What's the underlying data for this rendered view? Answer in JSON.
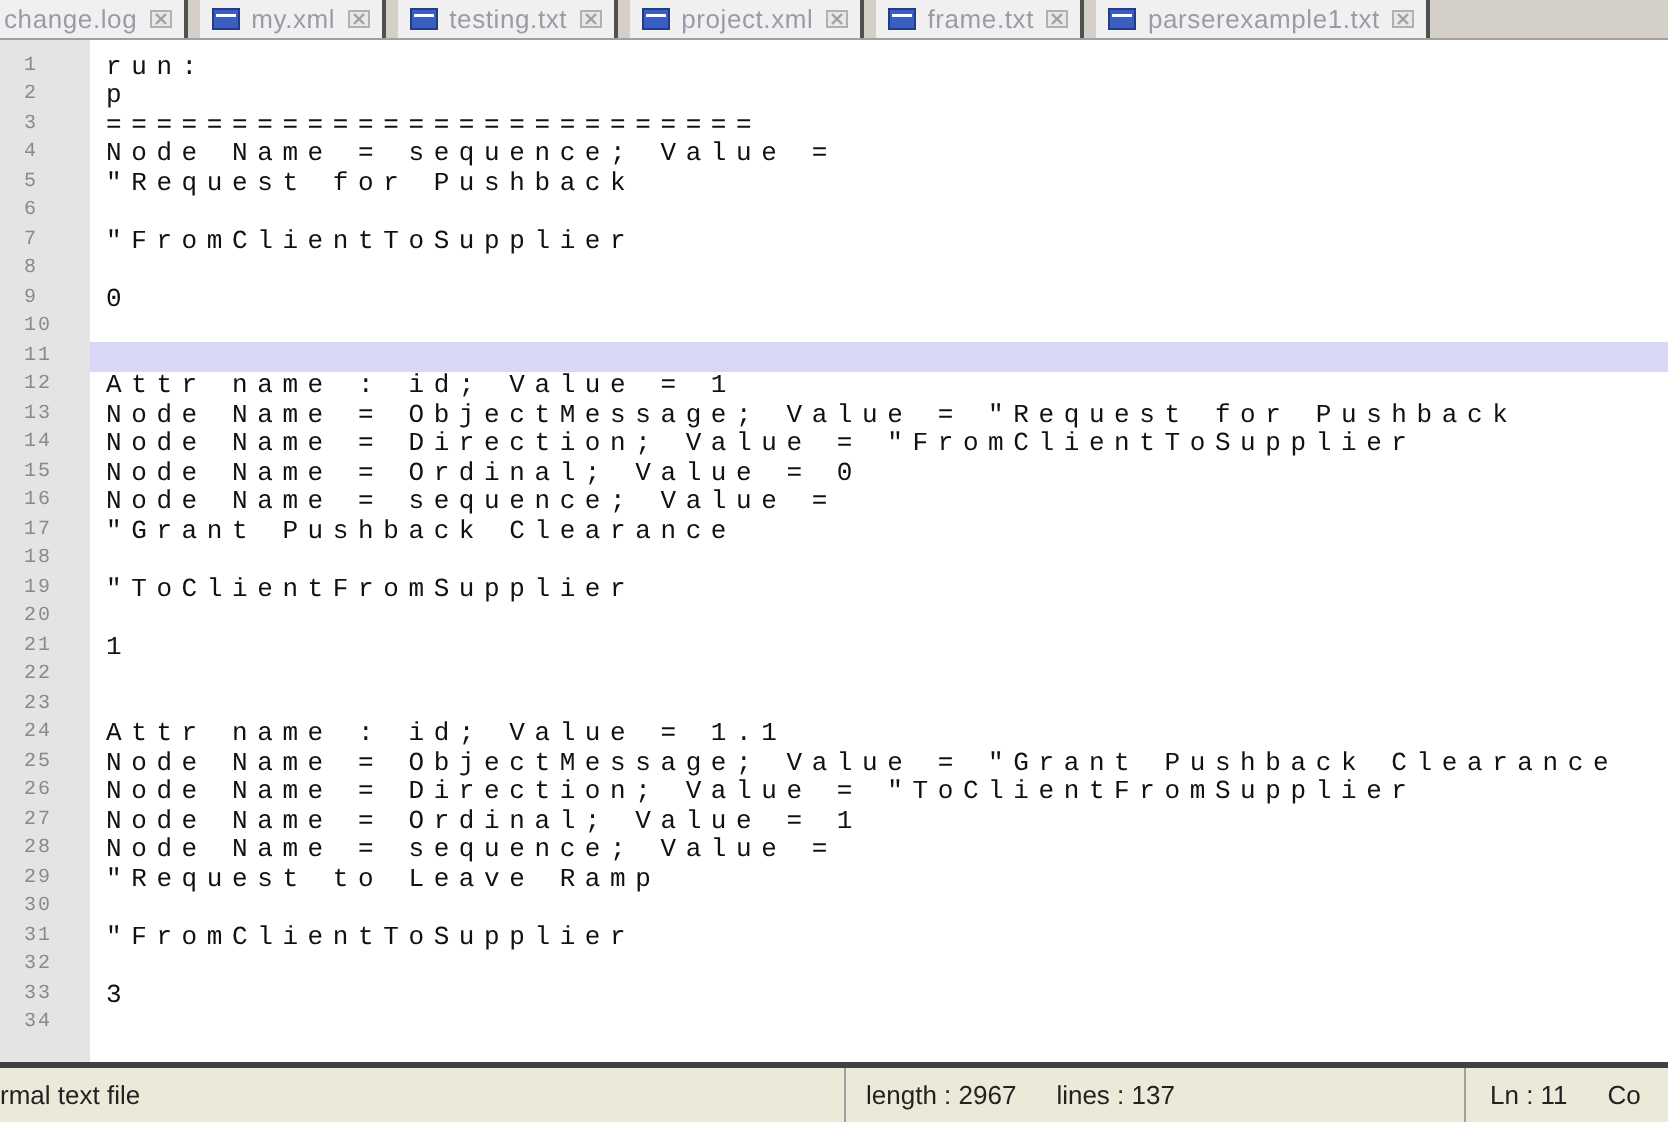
{
  "tabs": [
    {
      "label": "change.log",
      "selected": false
    },
    {
      "label": "my.xml",
      "selected": false
    },
    {
      "label": "testing.txt",
      "selected": false
    },
    {
      "label": "project.xml",
      "selected": false
    },
    {
      "label": "frame.txt",
      "selected": false
    },
    {
      "label": "parserexample1.txt",
      "selected": false
    }
  ],
  "editor": {
    "lines": [
      {
        "number": "1",
        "text": "run:",
        "current": false
      },
      {
        "number": "2",
        "text": "p",
        "current": false
      },
      {
        "number": "3",
        "text": "==========================",
        "current": false
      },
      {
        "number": "4",
        "text": "Node Name = sequence; Value =",
        "current": false
      },
      {
        "number": "5",
        "text": "\"Request for Pushback",
        "current": false
      },
      {
        "number": "6",
        "current": false
      },
      {
        "number": "7",
        "text": "\"FromClientToSupplier",
        "current": false
      },
      {
        "number": "8",
        "current": false
      },
      {
        "number": "9",
        "text": "0",
        "current": false
      },
      {
        "number": "10",
        "current": false
      },
      {
        "number": "11",
        "current": true
      },
      {
        "number": "12",
        "text": "Attr name : id; Value = 1",
        "current": false
      },
      {
        "number": "13",
        "text": "Node Name = ObjectMessage; Value = \"Request for Pushback",
        "current": false
      },
      {
        "number": "14",
        "text": "Node Name = Direction; Value = \"FromClientToSupplier",
        "current": false
      },
      {
        "number": "15",
        "text": "Node Name = Ordinal; Value = 0",
        "current": false
      },
      {
        "number": "16",
        "text": "Node Name = sequence; Value =",
        "current": false
      },
      {
        "number": "17",
        "text": "\"Grant Pushback Clearance",
        "current": false
      },
      {
        "number": "18",
        "current": false
      },
      {
        "number": "19",
        "text": "\"ToClientFromSupplier",
        "current": false
      },
      {
        "number": "20",
        "current": false
      },
      {
        "number": "21",
        "text": "1",
        "current": false
      },
      {
        "number": "22",
        "current": false
      },
      {
        "number": "23",
        "current": false
      },
      {
        "number": "24",
        "text": "Attr name : id; Value = 1.1",
        "current": false
      },
      {
        "number": "25",
        "text": "Node Name = ObjectMessage; Value = \"Grant Pushback Clearance",
        "current": false
      },
      {
        "number": "26",
        "text": "Node Name = Direction; Value = \"ToClientFromSupplier",
        "current": false
      },
      {
        "number": "27",
        "text": "Node Name = Ordinal; Value = 1",
        "current": false
      },
      {
        "number": "28",
        "text": "Node Name = sequence; Value =",
        "current": false
      },
      {
        "number": "29",
        "text": "\"Request to Leave Ramp",
        "current": false
      },
      {
        "number": "30",
        "current": false
      },
      {
        "number": "31",
        "text": "\"FromClientToSupplier",
        "current": false
      },
      {
        "number": "32",
        "current": false
      },
      {
        "number": "33",
        "text": "3",
        "current": false
      },
      {
        "number": "34",
        "current": false
      }
    ]
  },
  "status_bar": {
    "file_type": "rmal text file",
    "length": "length : 2967",
    "lines": "lines : 137",
    "position": "Ln : 11",
    "column": "Co"
  }
}
